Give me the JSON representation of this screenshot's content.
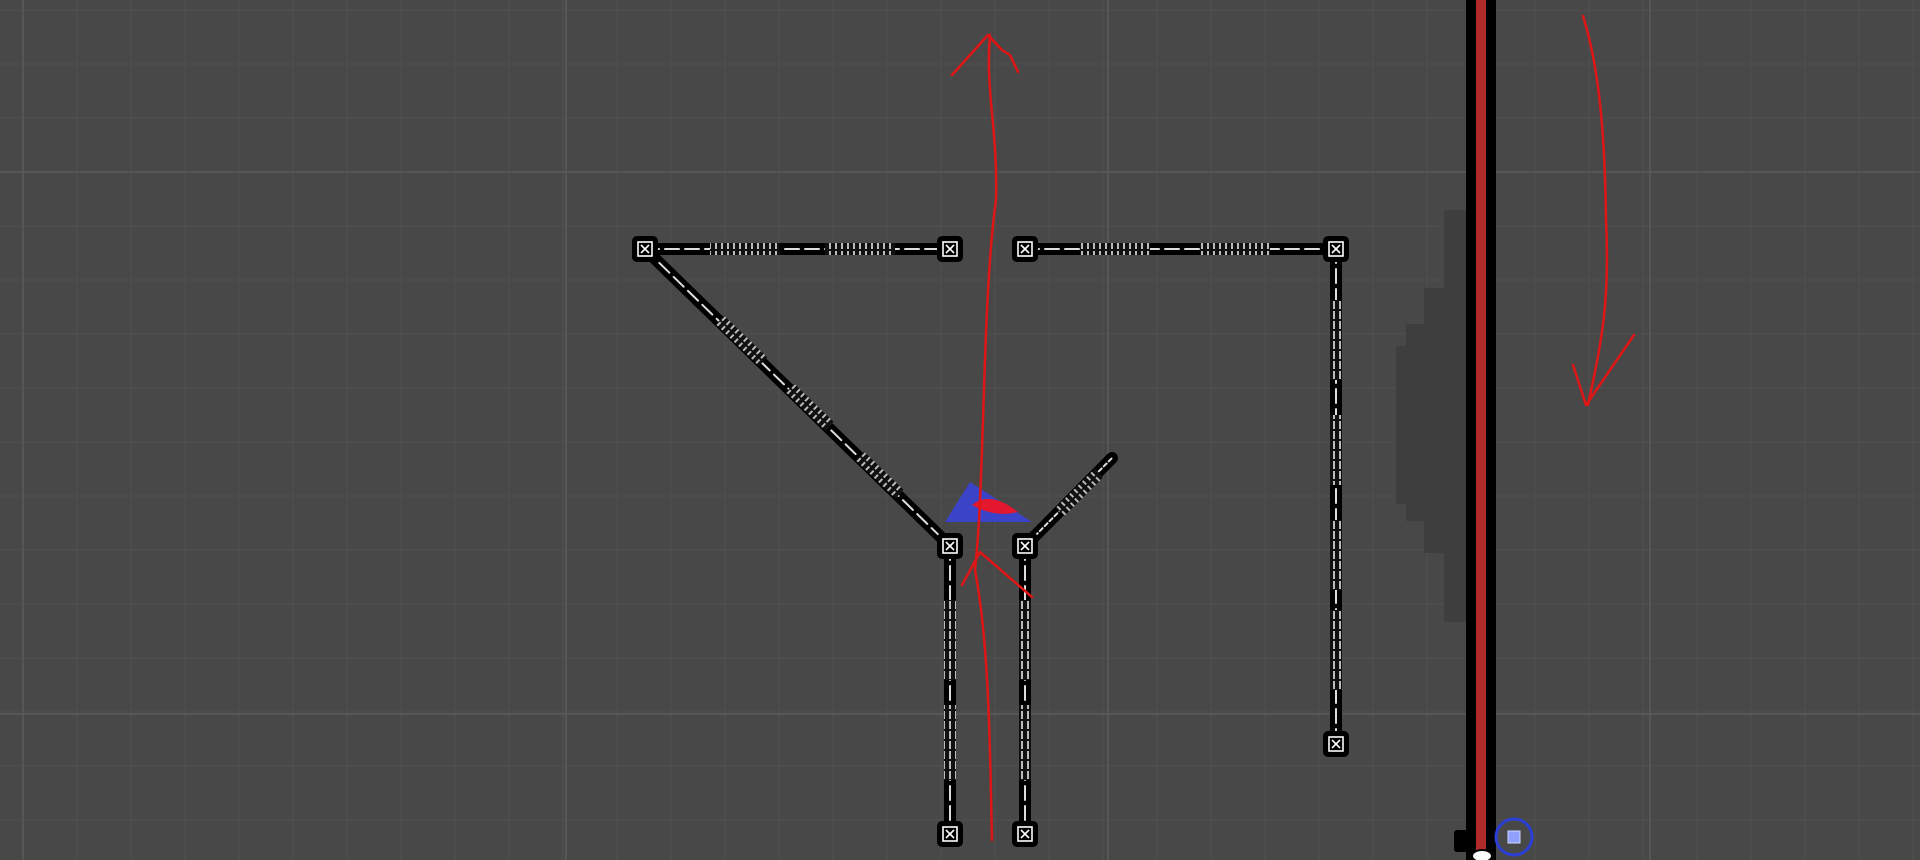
{
  "editor": {
    "view": "scene-view-2d",
    "grid": true
  },
  "colors": {
    "background": "#484848",
    "grid_major": "#5a5a5a",
    "grid_minor": "#4f4f4f",
    "rail_black": "#000000",
    "rail_red": "#b02a2a",
    "annotation_red": "#e01515",
    "player_blue": "#3b44c8",
    "player_red": "#e3172d",
    "shadow": "#3c3c3c",
    "gizmo_circle": "#2b3fd6"
  },
  "icons": {
    "node": "anchor-node-icon",
    "gizmo": "selection-gizmo-icon"
  }
}
